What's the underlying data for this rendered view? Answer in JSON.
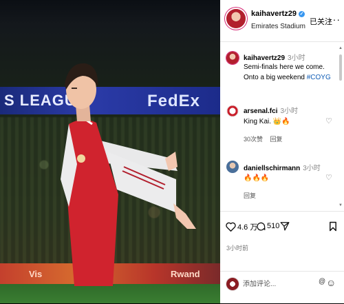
{
  "photo": {
    "banner_text": "S LEAGUE",
    "sponsor": "FedEx",
    "adboard_left": "Vis",
    "adboard_right": "Rwand"
  },
  "header": {
    "username": "kaihavertz29",
    "location": "Emirates Stadium",
    "follow_label": "已关注",
    "more_icon": "···",
    "verified_icon": "✓"
  },
  "caption": {
    "username": "kaihavertz29",
    "time": "3小时",
    "text": "Semi-finals here we come. Onto a big weekend ",
    "hashtag": "#COYG"
  },
  "comments": [
    {
      "username": "arsenal.fci",
      "time": "3小时",
      "text": "King Kai. 👑🔥",
      "likes": "30次赞",
      "reply": "回复",
      "heart_icon": "♡"
    },
    {
      "username": "daniellschirmann",
      "time": "3小时",
      "text": "🔥🔥🔥",
      "reply": "回复",
      "heart_icon": "♡"
    }
  ],
  "actions": {
    "like_count": "4.6 万",
    "comment_count": "510",
    "time_ago": "3小时前"
  },
  "add_comment": {
    "placeholder": "添加评论...",
    "mention_icon": "@",
    "emoji_icon": "☺"
  },
  "colors": {
    "link": "#0d5bb5",
    "verified": "#3897f0",
    "jersey_red": "#d0232e"
  }
}
